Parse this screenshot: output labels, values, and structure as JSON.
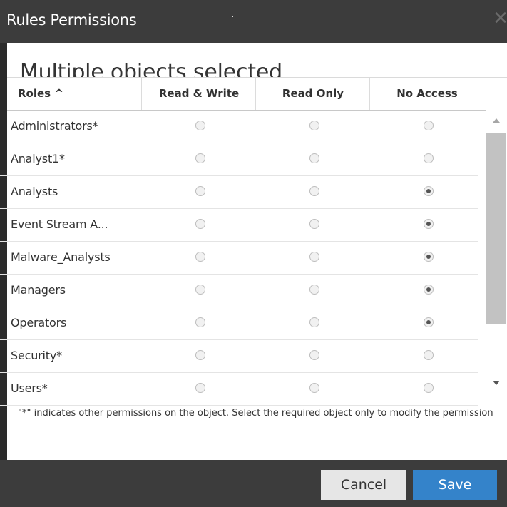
{
  "dialog": {
    "title": "Rules Permissions",
    "close_glyph": "✕",
    "heading": "Multiple objects selected"
  },
  "table": {
    "columns": [
      "Roles ^",
      "Read & Write",
      "Read Only",
      "No Access"
    ],
    "rows": [
      {
        "role": "Administrators*",
        "selected": null
      },
      {
        "role": "Analyst1*",
        "selected": null
      },
      {
        "role": "Analysts",
        "selected": "No Access"
      },
      {
        "role": "Event Stream A...",
        "selected": "No Access"
      },
      {
        "role": "Malware_Analysts",
        "selected": "No Access"
      },
      {
        "role": "Managers",
        "selected": "No Access"
      },
      {
        "role": "Operators",
        "selected": "No Access"
      },
      {
        "role": "Security*",
        "selected": null
      },
      {
        "role": "Users*",
        "selected": null
      }
    ]
  },
  "note": "\"*\" indicates other permissions on the object. Select the required object only to modify the permission",
  "buttons": {
    "cancel": "Cancel",
    "save": "Save"
  },
  "colors": {
    "titlebar": "#3c3c3c",
    "accent": "#3483ca"
  }
}
